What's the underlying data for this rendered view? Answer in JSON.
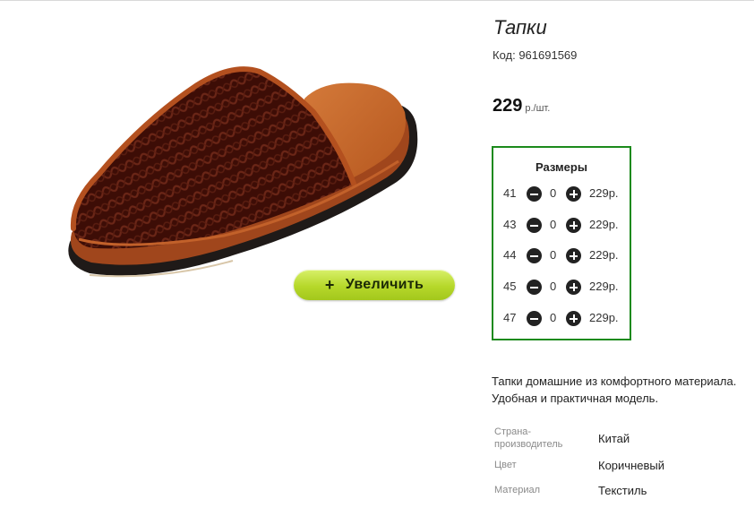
{
  "product": {
    "title": "Тапки",
    "code_text": "Код: 961691569",
    "price_value": "229",
    "price_unit": "р./шт.",
    "zoom_button": {
      "plus_symbol": "+",
      "label": "Увеличить"
    },
    "image_icon": "brown-velour-slipper"
  },
  "sizes": {
    "title": "Размеры",
    "rows": [
      {
        "size": "41",
        "qty": "0",
        "price": "229р."
      },
      {
        "size": "43",
        "qty": "0",
        "price": "229р."
      },
      {
        "size": "44",
        "qty": "0",
        "price": "229р."
      },
      {
        "size": "45",
        "qty": "0",
        "price": "229р."
      },
      {
        "size": "47",
        "qty": "0",
        "price": "229р."
      }
    ]
  },
  "description": {
    "line1": "Тапки домашние из комфортного материала.",
    "line2": "Удобная и практичная модель."
  },
  "specs": [
    {
      "label_line1": "Страна-",
      "label_line2": "производитель",
      "value": "Китай"
    },
    {
      "label_line1": "Цвет",
      "label_line2": "",
      "value": "Коричневый"
    },
    {
      "label_line1": "Материал",
      "label_line2": "",
      "value": "Текстиль"
    }
  ],
  "colors": {
    "accent_green": "#1c8a1c",
    "button_lime": "#b6d82a"
  }
}
